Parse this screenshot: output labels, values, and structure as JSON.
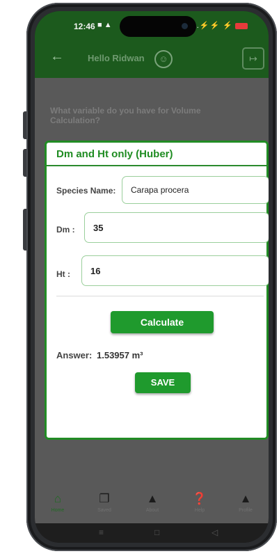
{
  "status_bar": {
    "time": "12:46",
    "left_icons": "■ ▲",
    "right_icons": "⏰ ☷ .⚡⚡ ⚡"
  },
  "app_bar": {
    "back_icon": "arrow-left-icon",
    "greeting": "Hello Ridwan",
    "smiley_glyph": "☺",
    "logout_glyph": "↦"
  },
  "background_prompt": "What variable do you have for Volume Calculation?",
  "dialog": {
    "title": "Dm and Ht only (Huber)",
    "species_label": "Species Name:",
    "species_value": "Carapa procera",
    "dm_label": "Dm :",
    "dm_value": "35",
    "ht_label": "Ht :",
    "ht_value": "16",
    "calculate_label": "Calculate",
    "answer_label": "Answer:",
    "answer_value": "1.53957 m³",
    "save_label": "SAVE"
  },
  "bottom_nav": [
    {
      "label": "Home",
      "icon": "home-icon",
      "glyph": "⌂"
    },
    {
      "label": "Saved",
      "icon": "saved-icon",
      "glyph": "❐"
    },
    {
      "label": "About",
      "icon": "person-icon",
      "glyph": "▲"
    },
    {
      "label": "Help",
      "icon": "help-icon",
      "glyph": "❓"
    },
    {
      "label": "Profile",
      "icon": "profile-icon",
      "glyph": "▲"
    }
  ],
  "system_nav": {
    "menu_glyph": "≡",
    "home_glyph": "□",
    "back_glyph": "◁"
  },
  "colors": {
    "primary_green": "#1c5a1d",
    "button_green": "#1f9a2d",
    "dialog_border": "#218c24",
    "overlay_gray": "#595959"
  }
}
